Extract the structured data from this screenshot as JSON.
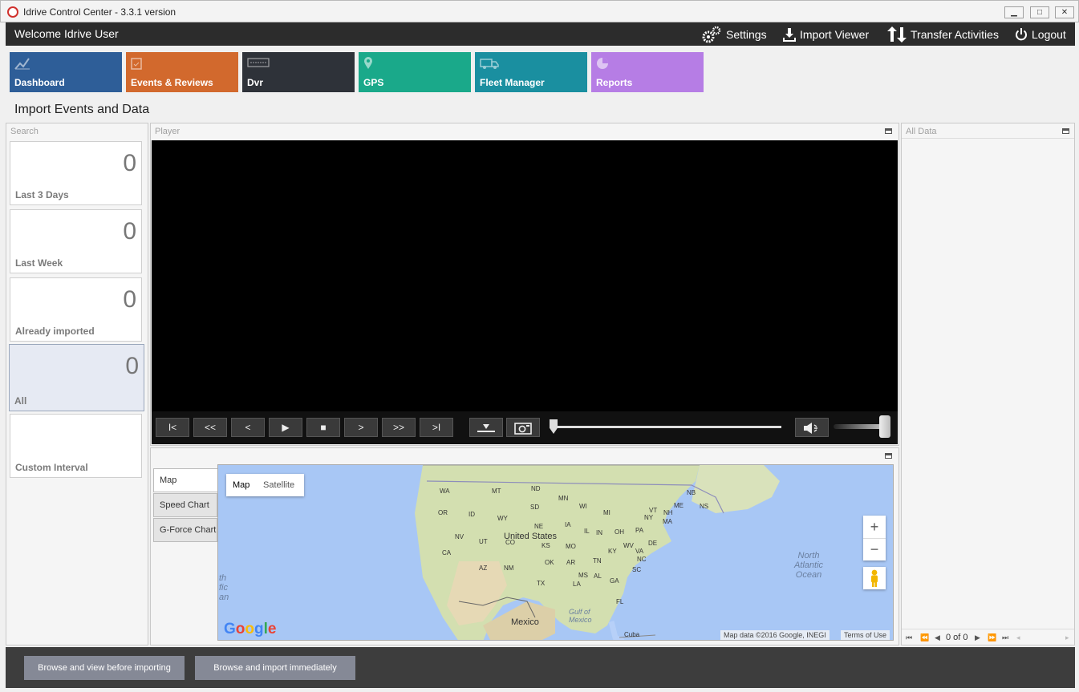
{
  "window": {
    "title": "Idrive Control Center - 3.3.1 version",
    "minimize": "▁",
    "maximize": "□",
    "close": "✕"
  },
  "header": {
    "welcome": "Welcome Idrive User",
    "settings": "Settings",
    "import_viewer": "Import Viewer",
    "transfer": "Transfer Activities",
    "logout": "Logout"
  },
  "nav": {
    "tiles": [
      {
        "label": "Dashboard",
        "color": "#2e5e98",
        "icon": "chart-icon"
      },
      {
        "label": "Events & Reviews",
        "color": "#d2692d",
        "icon": "clipboard-icon"
      },
      {
        "label": "Dvr",
        "color": "#2e3239",
        "icon": "dvr-icon"
      },
      {
        "label": "GPS",
        "color": "#1aa98a",
        "icon": "pin-icon"
      },
      {
        "label": "Fleet Manager",
        "color": "#1a8fa0",
        "icon": "truck-icon"
      },
      {
        "label": "Reports",
        "color": "#b67de5",
        "icon": "pie-icon"
      }
    ]
  },
  "page": {
    "heading": "Import Events and Data"
  },
  "search": {
    "title": "Search",
    "cards": [
      {
        "count": "0",
        "label": "Last 3 Days"
      },
      {
        "count": "0",
        "label": "Last Week"
      },
      {
        "count": "0",
        "label": "Already imported"
      },
      {
        "count": "0",
        "label": "All"
      },
      {
        "count": "",
        "label": "Custom Interval"
      }
    ]
  },
  "player": {
    "title": "Player",
    "buttons": [
      "I<",
      "<<",
      "<",
      "▶",
      "■",
      ">",
      ">>",
      ">I"
    ],
    "progress": 0,
    "volume": 1.0
  },
  "tabs": [
    "Map",
    "Speed Chart",
    "G-Force Chart"
  ],
  "map": {
    "types": [
      "Map",
      "Satellite"
    ],
    "attribution": "Map data ©2016 Google, INEGI",
    "terms": "Terms of Use",
    "zoom_in": "+",
    "zoom_out": "−",
    "logo": "Google",
    "labels": {
      "mexico": "Mexico",
      "cuba": "Cuba",
      "gulf": "Gulf of Mexico",
      "atlantic": "North Atlantic Ocean",
      "pacific_frag": "th fic an",
      "us": "United States"
    },
    "states": [
      "WA",
      "MT",
      "ND",
      "MN",
      "OR",
      "ID",
      "SD",
      "WI",
      "MI",
      "WY",
      "NE",
      "IA",
      "NV",
      "UT",
      "CO",
      "KS",
      "MO",
      "IL",
      "IN",
      "OH",
      "PA",
      "NY",
      "CA",
      "AZ",
      "NM",
      "OK",
      "AR",
      "TN",
      "KY",
      "WV",
      "VA",
      "TX",
      "LA",
      "MS",
      "AL",
      "GA",
      "SC",
      "NC",
      "FL",
      "ME",
      "NH",
      "VT",
      "MA",
      "NB",
      "NS",
      "DE"
    ]
  },
  "alldata": {
    "title": "All Data",
    "pager": "0 of 0"
  },
  "footer": {
    "browse_view": "Browse and view before importing",
    "browse_import": "Browse and import immediately"
  }
}
